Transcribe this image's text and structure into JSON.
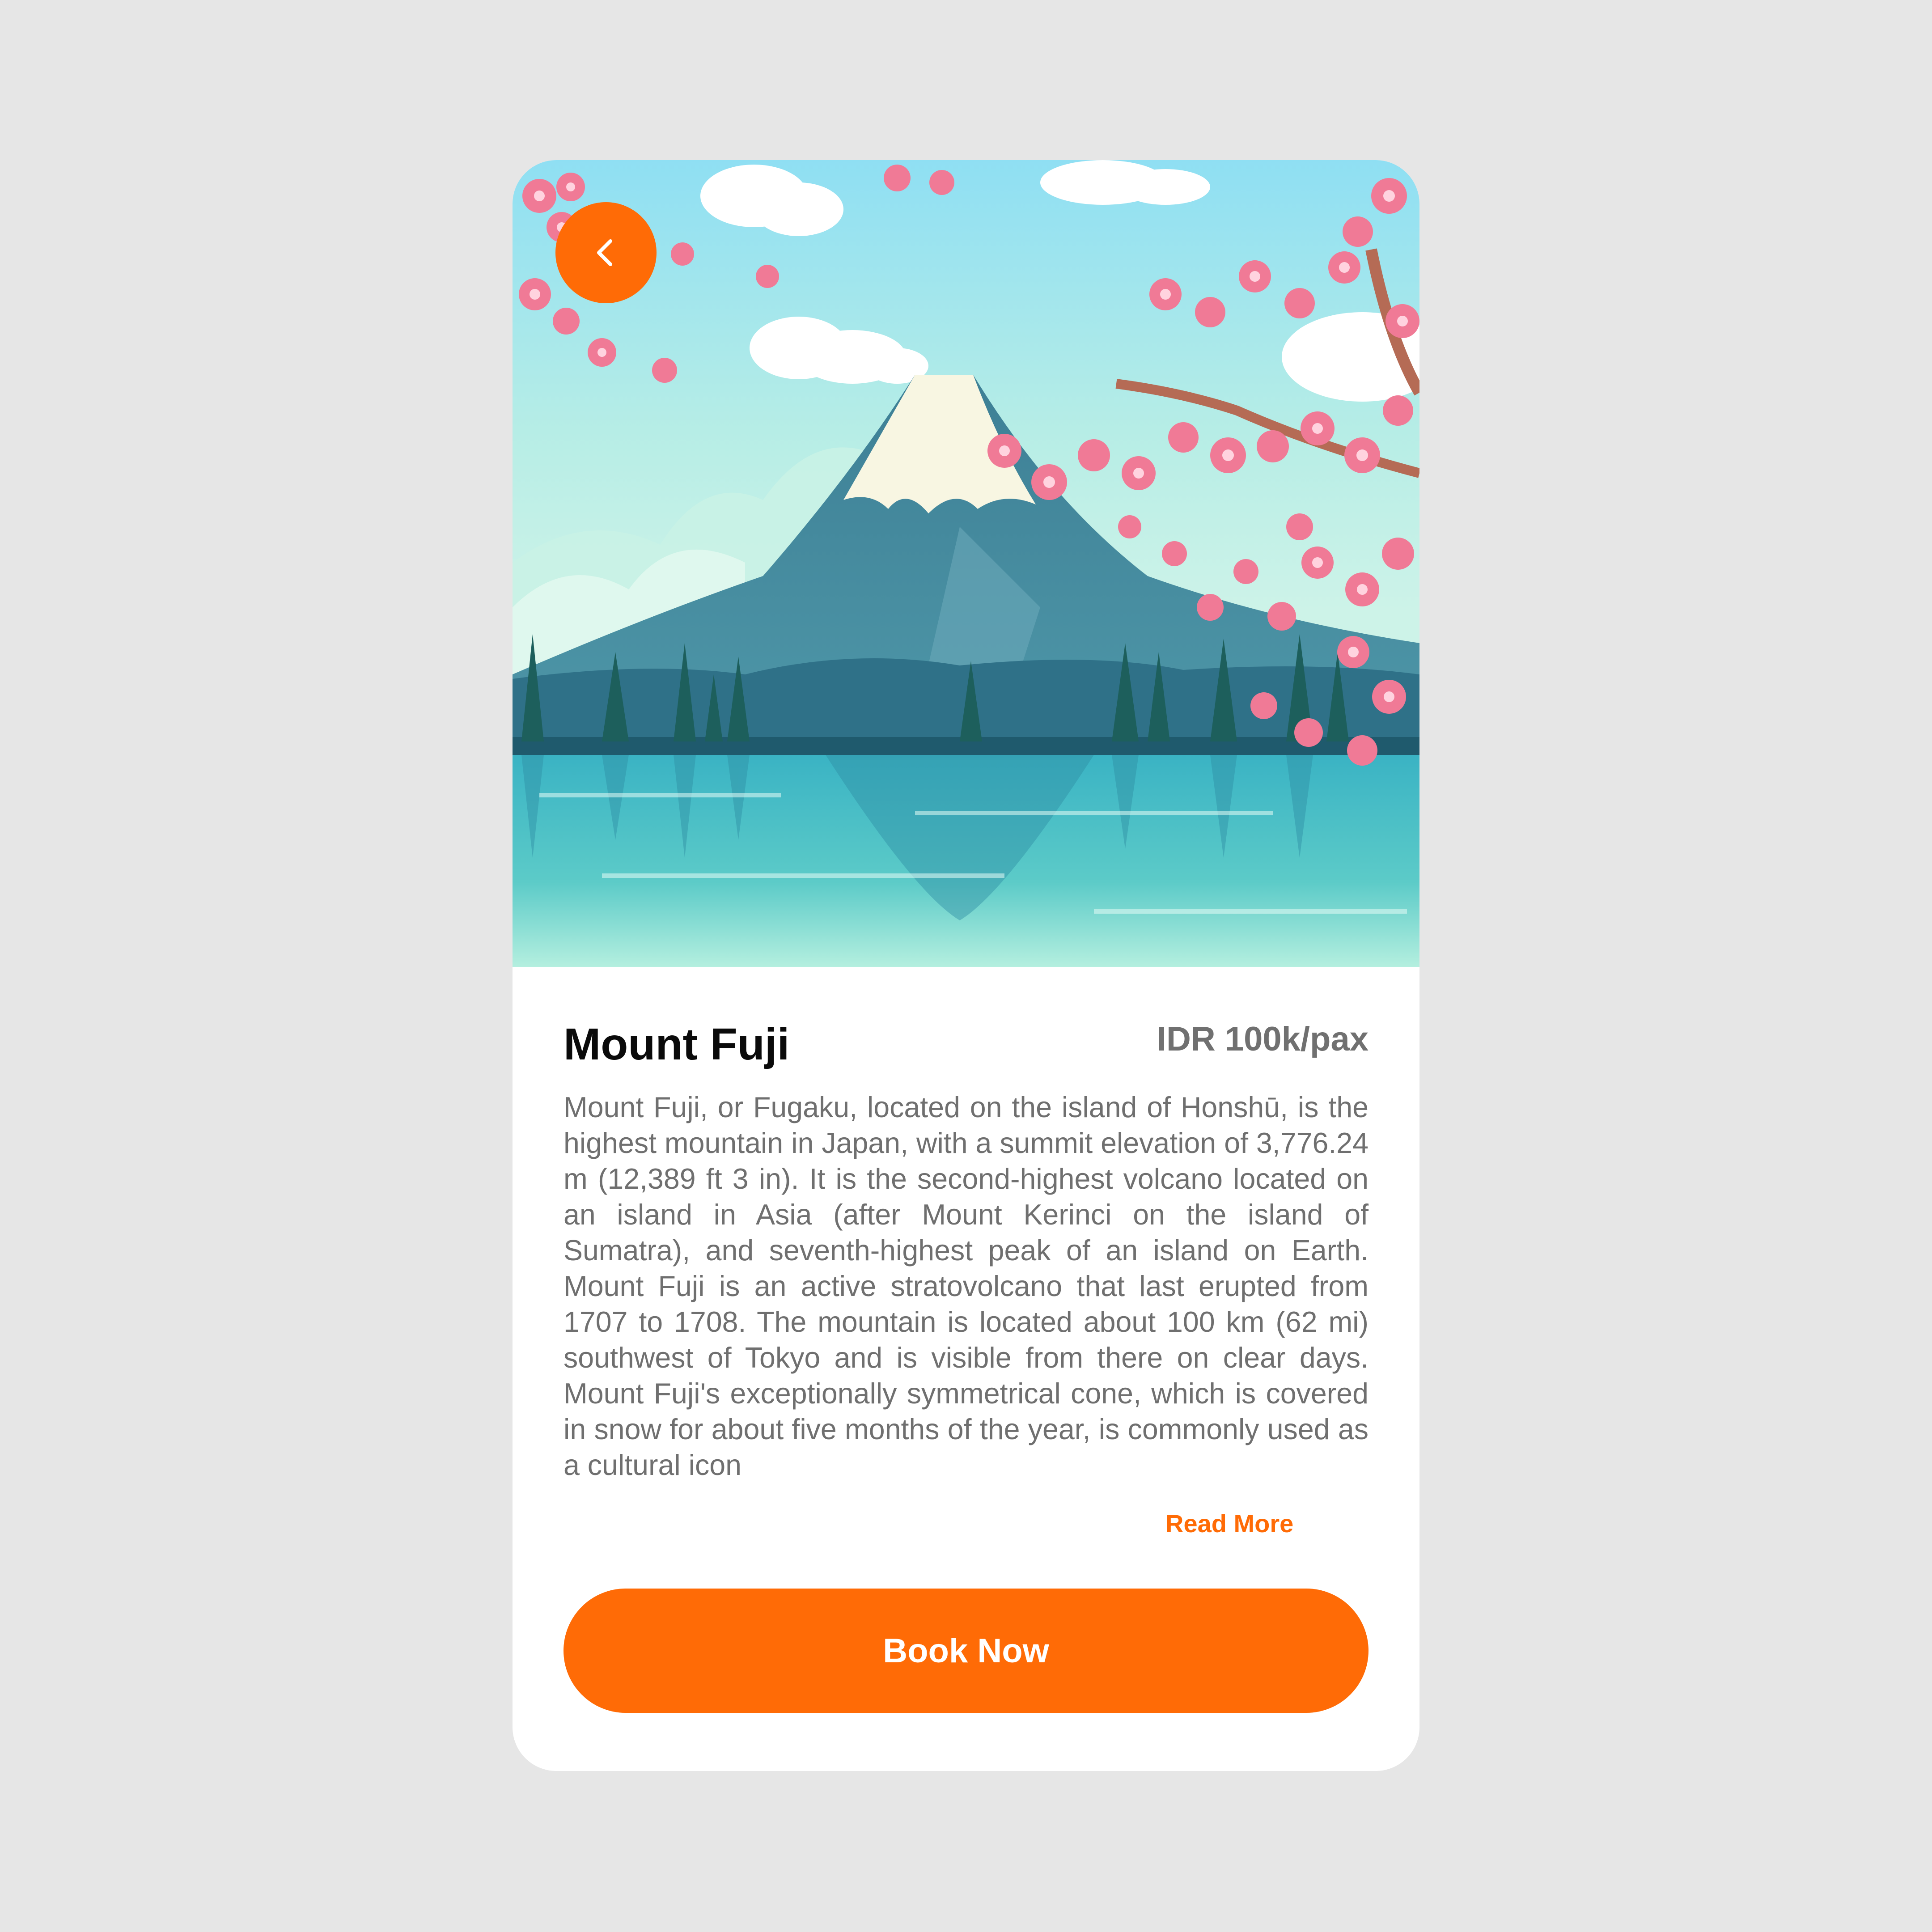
{
  "hero": {
    "image_alt": "Illustration of Mount Fuji with cherry blossoms and a lake",
    "back_icon": "chevron-left-icon"
  },
  "place": {
    "title": "Mount Fuji",
    "price": "IDR 100k/pax",
    "description": "Mount Fuji, or Fugaku, located on the island of Honshū, is the highest mountain in Japan, with a summit elevation of 3,776.24 m (12,389 ft 3 in). It is the second-highest volcano located on an island in Asia (after Mount Kerinci on the island of Sumatra), and seventh-highest peak of an island on Earth. Mount Fuji is an active stratovolcano that last erupted from 1707 to 1708. The mountain is located about 100 km (62 mi) southwest of Tokyo and is visible from there on clear days. Mount Fuji's exceptionally symmetrical cone, which is covered in snow for about five months of the year, is commonly used as a cultural icon",
    "read_more_label": "Read More"
  },
  "actions": {
    "book_label": "Book Now"
  },
  "colors": {
    "accent": "#ff6b06",
    "background": "#e6e6e6",
    "card": "#ffffff",
    "title": "#0a0a0a",
    "muted_text": "#6f6f6f"
  }
}
